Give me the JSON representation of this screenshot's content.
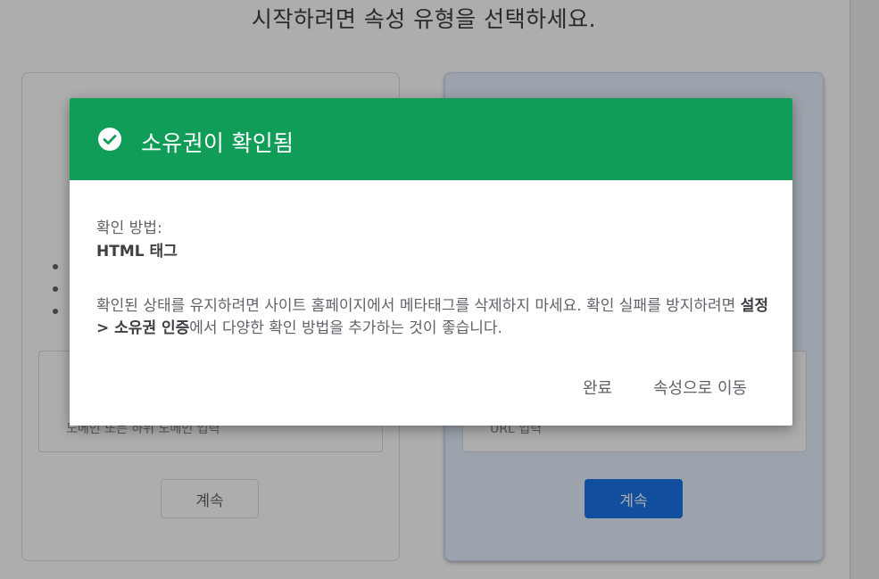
{
  "background": {
    "heading": "시작하려면 속성 유형을 선택하세요.",
    "left_card": {
      "placeholder": "도메인 또는 하위 도메인 입력",
      "continue_label": "계속"
    },
    "right_card": {
      "placeholder": "URL 입력",
      "continue_label": "계속"
    }
  },
  "dialog": {
    "title": "소유권이 확인됨",
    "icon": "check-circle-icon",
    "header_color": "#0f9d58",
    "method_label": "확인 방법:",
    "method_value": "HTML 태그",
    "desc_part1": "확인된 상태를 유지하려면 사이트 홈페이지에서 메타태그를 삭제하지 마세요. 확인 실패를 방지하려면 ",
    "desc_bold": "설정 > 소유권 인증",
    "desc_part2": "에서 다양한 확인 방법을 추가하는 것이 좋습니다.",
    "done_label": "완료",
    "go_label": "속성으로 이동"
  }
}
